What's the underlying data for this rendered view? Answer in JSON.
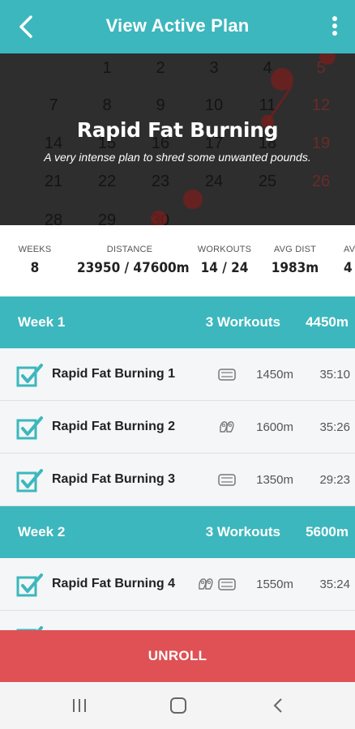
{
  "header": {
    "title": "View Active Plan",
    "back_icon": "chevron-left-icon",
    "menu_icon": "more-vert-icon"
  },
  "hero": {
    "title": "Rapid Fat Burning",
    "subtitle": "A very intense plan to shred some unwanted pounds.",
    "calendar_numbers": [
      "1",
      "2",
      "3",
      "4",
      "5",
      "7",
      "8",
      "9",
      "10",
      "11",
      "12",
      "14",
      "15",
      "16",
      "17",
      "18",
      "19",
      "21",
      "22",
      "23",
      "24",
      "25",
      "26",
      "28",
      "29",
      "30"
    ]
  },
  "stats": [
    {
      "label": "WEEKS",
      "value": "8"
    },
    {
      "label": "DISTANCE",
      "value": "23950 / 47600m"
    },
    {
      "label": "WORKOUTS",
      "value": "14 / 24"
    },
    {
      "label": "AVG DIST",
      "value": "1983m"
    },
    {
      "label": "AV",
      "value": "4"
    }
  ],
  "weeks": [
    {
      "name": "Week 1",
      "workouts": "3 Workouts",
      "distance": "4450m",
      "items": [
        {
          "name": "Rapid Fat Burning 1",
          "distance": "1450m",
          "time": "35:10",
          "icons": [
            "swim-board-icon"
          ],
          "done": true
        },
        {
          "name": "Rapid Fat Burning 2",
          "distance": "1600m",
          "time": "35:26",
          "icons": [
            "fins-icon"
          ],
          "done": true
        },
        {
          "name": "Rapid Fat Burning 3",
          "distance": "1350m",
          "time": "29:23",
          "icons": [
            "swim-board-icon"
          ],
          "done": true
        }
      ]
    },
    {
      "name": "Week 2",
      "workouts": "3 Workouts",
      "distance": "5600m",
      "items": [
        {
          "name": "Rapid Fat Burning 4",
          "distance": "1550m",
          "time": "35:24",
          "icons": [
            "fins-icon",
            "swim-board-icon"
          ],
          "done": true
        }
      ]
    }
  ],
  "unroll_label": "UNROLL",
  "colors": {
    "primary": "#3cb7bd",
    "danger": "#df5155",
    "row_bg": "#f4f6f7"
  }
}
